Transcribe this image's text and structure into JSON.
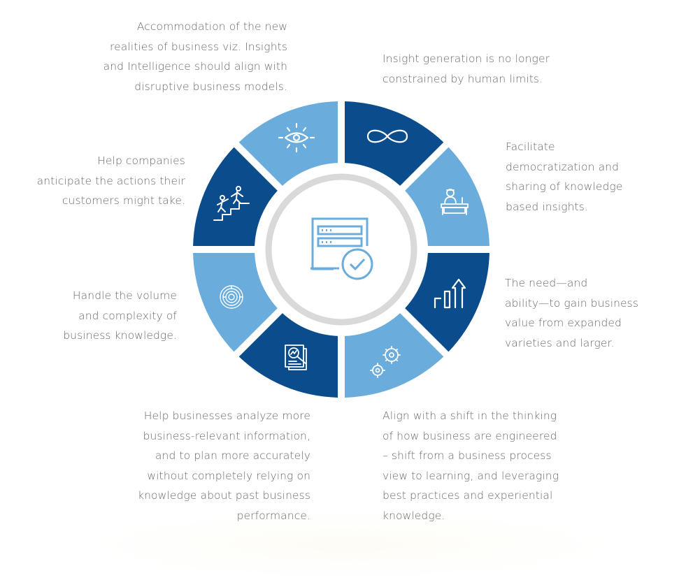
{
  "colors": {
    "dark": "#0b4c8c",
    "light": "#6aacdc",
    "ring": "#d9d9d9",
    "center_icon": "#6aacdc",
    "text": "#6b6b6b"
  },
  "center": {
    "icon": "server-check-icon"
  },
  "segments": [
    {
      "id": "infinity",
      "icon": "infinity-icon",
      "shade": "dark",
      "text": [
        "Insight generation is no longer",
        "constrained by human limits."
      ]
    },
    {
      "id": "teacher",
      "icon": "presenter-icon",
      "shade": "light",
      "text": [
        "Facilitate",
        "democratization and",
        "sharing of knowledge",
        "based insights."
      ]
    },
    {
      "id": "chart",
      "icon": "growth-chart-icon",
      "shade": "dark",
      "text": [
        "The need—and",
        "ability—to gain business",
        "value from expanded",
        "varieties and larger."
      ]
    },
    {
      "id": "gears",
      "icon": "gears-icon",
      "shade": "light",
      "text": [
        "Align with a shift in the thinking",
        "of how business are engineered",
        "– shift from a business process",
        "view to learning, and leveraging",
        "best practices and experiential",
        "knowledge."
      ]
    },
    {
      "id": "report",
      "icon": "report-analysis-icon",
      "shade": "dark",
      "text": [
        "Help businesses analyze more",
        "business-relevant information,",
        "and to plan more accurately",
        "without completely relying on",
        "knowledge about past business",
        "performance."
      ]
    },
    {
      "id": "maze",
      "icon": "maze-icon",
      "shade": "light",
      "text": [
        "Handle the volume",
        "and complexity of",
        "business knowledge."
      ]
    },
    {
      "id": "climb",
      "icon": "helping-climb-icon",
      "shade": "dark",
      "text": [
        "Help companies",
        "anticipate the actions their",
        "customers might take."
      ]
    },
    {
      "id": "eye",
      "icon": "vision-eye-icon",
      "shade": "light",
      "text": [
        "Accommodation of the new",
        "realities of business viz.  Insights",
        "and Intelligence should align with",
        "disruptive business models."
      ]
    }
  ]
}
